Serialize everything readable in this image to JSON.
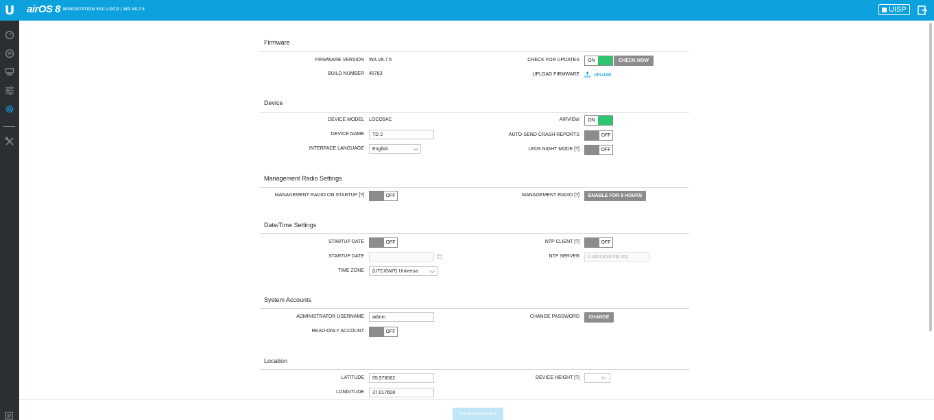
{
  "header": {
    "brand": "airOS 8",
    "subtitle": "NANOSTATION 5AC LOCO | WA.V8.7.5",
    "uisp_label": "UISP"
  },
  "colors": {
    "accent": "#0da2dd",
    "toggle_on": "#2dc56f",
    "toggle_off": "#8c8c8c",
    "sidebar": "#2b2e33"
  },
  "sidebar": {
    "items": [
      {
        "icon": "dashboard-icon"
      },
      {
        "icon": "wireless-icon"
      },
      {
        "icon": "network-icon"
      },
      {
        "icon": "services-icon"
      },
      {
        "icon": "settings-gear-icon",
        "active": true
      },
      {
        "icon": "tools-icon"
      }
    ]
  },
  "firmware": {
    "title": "Firmware",
    "version_label": "FIRMWARE VERSION",
    "version_value": "WA.V8.7.5",
    "build_label": "BUILD NUMBER",
    "build_value": "45783",
    "check_label": "CHECK FOR UPDATES",
    "check_state": "ON",
    "check_now": "CHECK NOW",
    "upload_label": "UPLOAD FIRMWARE",
    "upload_link": "UPLOAD"
  },
  "device": {
    "title": "Device",
    "model_label": "DEVICE MODEL",
    "model_value": "LOCO5AC",
    "name_label": "DEVICE NAME",
    "name_value": "TD 2",
    "lang_label": "INTERFACE LANGUAGE",
    "lang_value": "English",
    "airview_label": "AIRVIEW",
    "airview_state": "ON",
    "crash_label": "AUTO-SEND CRASH REPORTS",
    "crash_state": "OFF",
    "leds_label": "LEDS NIGHT MODE [?]",
    "leds_state": "OFF"
  },
  "mgmt": {
    "title": "Management Radio Settings",
    "startup_label": "MANAGEMENT RADIO ON STARTUP [?]",
    "startup_state": "OFF",
    "radio_label": "MANAGEMENT RADIO [?]",
    "radio_button": "ENABLE FOR 8 HOURS"
  },
  "datetime": {
    "title": "Date/Time Settings",
    "startup_label": "STARTUP DATE",
    "startup_state": "OFF",
    "startup_date_label": "STARTUP DATE",
    "startup_date_value": "",
    "tz_label": "TIME ZONE",
    "tz_value": "(UTC/GMT) Universa",
    "ntp_client_label": "NTP CLIENT [?]",
    "ntp_client_state": "OFF",
    "ntp_server_label": "NTP SERVER",
    "ntp_server_placeholder": "0.ubnt.pool.ntp.org"
  },
  "accounts": {
    "title": "System Accounts",
    "admin_label": "ADMINISTRATOR USERNAME",
    "admin_value": "admin",
    "readonly_label": "READ-ONLY ACCOUNT",
    "readonly_state": "OFF",
    "password_label": "CHANGE PASSWORD",
    "password_button": "CHANGE"
  },
  "location": {
    "title": "Location",
    "lat_label": "LATITUDE",
    "lat_value": "55.578062",
    "lon_label": "LONGITUDE",
    "lon_value": "37.017608",
    "height_label": "DEVICE HEIGHT [?]",
    "height_unit": "m."
  },
  "footer": {
    "save_label": "SAVE CHANGES"
  }
}
